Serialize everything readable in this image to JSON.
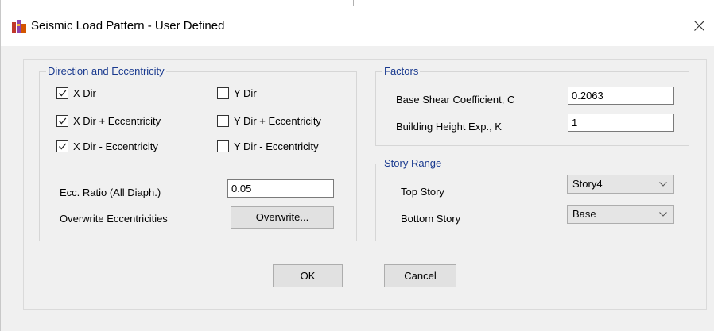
{
  "window": {
    "title": "Seismic Load Pattern - User Defined"
  },
  "direction_group": {
    "title": "Direction and Eccentricity",
    "checkboxes": [
      {
        "label": "X Dir",
        "checked": true
      },
      {
        "label": "X Dir + Eccentricity",
        "checked": true
      },
      {
        "label": "X Dir - Eccentricity",
        "checked": true
      },
      {
        "label": "Y Dir",
        "checked": false
      },
      {
        "label": "Y Dir + Eccentricity",
        "checked": false
      },
      {
        "label": "Y Dir - Eccentricity",
        "checked": false
      }
    ],
    "ecc_ratio_label": "Ecc. Ratio (All Diaph.)",
    "ecc_ratio_value": "0.05",
    "overwrite_label": "Overwrite Eccentricities",
    "overwrite_button": "Overwrite..."
  },
  "factors_group": {
    "title": "Factors",
    "base_shear_label": "Base Shear Coefficient, C",
    "base_shear_value": "0.2063",
    "height_exp_label": "Building Height Exp., K",
    "height_exp_value": "1"
  },
  "story_range_group": {
    "title": "Story Range",
    "top_story_label": "Top Story",
    "top_story_value": "Story4",
    "bottom_story_label": "Bottom Story",
    "bottom_story_value": "Base"
  },
  "buttons": {
    "ok": "OK",
    "cancel": "Cancel"
  },
  "colors": {
    "group_title": "#1a3a8f",
    "dialog_bg": "#f0f0f0",
    "button_bg": "#e1e1e1"
  },
  "icons": {
    "app": "app-icon",
    "close": "close-icon",
    "check": "checkmark-icon",
    "dropdown": "chevron-down-icon"
  }
}
